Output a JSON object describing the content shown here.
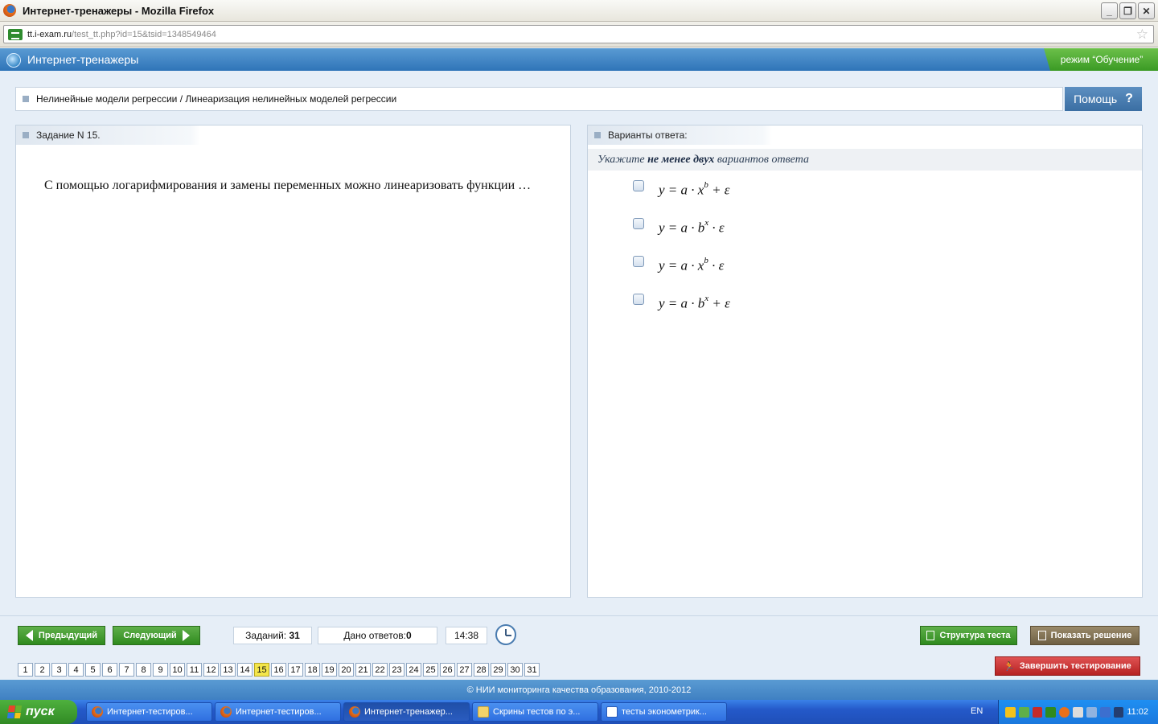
{
  "window": {
    "title": "Интернет-тренажеры - Mozilla Firefox",
    "url_domain": "tt.i-exam.ru",
    "url_path": "/test_tt.php?id=15&tsid=1348549464"
  },
  "app": {
    "title": "Интернет-тренажеры",
    "mode": "режим “Обучение”"
  },
  "topic": {
    "text": "Нелинейные модели регрессии / Линеаризация нелинейных моделей регрессии",
    "help_label": "Помощь",
    "help_symbol": "?"
  },
  "task": {
    "header": "Задание N 15.",
    "question": "С помощью логарифмирования и замены переменных можно линеаризовать функции …"
  },
  "answers": {
    "header": "Варианты ответа:",
    "instruction_pre": "Укажите ",
    "instruction_bold": "не менее двух",
    "instruction_post": " вариантов ответа",
    "options": [
      {
        "base": "y = a · x",
        "exp": "b",
        "tail": " + ε"
      },
      {
        "base": "y = a · b",
        "exp": "x",
        "tail": " · ε"
      },
      {
        "base": "y = a · x",
        "exp": "b",
        "tail": " · ε"
      },
      {
        "base": "y = a · b",
        "exp": "x",
        "tail": " + ε"
      }
    ]
  },
  "nav": {
    "prev_label": "Предыдущий",
    "next_label": "Следующий",
    "tasks_label": "Заданий:",
    "tasks_count": "31",
    "answers_label": "Дано ответов:",
    "answers_count": "0",
    "timer": "14:38",
    "structure_label": "Структура теста",
    "solution_label": "Показать решение",
    "finish_label": "Завершить тестирование",
    "pages": [
      "1",
      "2",
      "3",
      "4",
      "5",
      "6",
      "7",
      "8",
      "9",
      "10",
      "11",
      "12",
      "13",
      "14",
      "15",
      "16",
      "17",
      "18",
      "19",
      "20",
      "21",
      "22",
      "23",
      "24",
      "25",
      "26",
      "27",
      "28",
      "29",
      "30",
      "31"
    ],
    "current_page": "15"
  },
  "footer": {
    "copyright": "© НИИ мониторинга качества образования, 2010-2012"
  },
  "taskbar": {
    "start_label": "пуск",
    "tasks": [
      {
        "label": "Интернет-тестиров...",
        "icon": "firefox-icon"
      },
      {
        "label": "Интернет-тестиров...",
        "icon": "firefox-icon"
      },
      {
        "label": "Интернет-тренажер...",
        "icon": "firefox-icon"
      },
      {
        "label": "Скрины тестов по э...",
        "icon": "folder-icon"
      },
      {
        "label": "тесты эконометрик...",
        "icon": "word-icon"
      }
    ],
    "language": "EN",
    "clock": "11:02"
  },
  "colors": {
    "header_blue": "#2f74b8",
    "accent_green": "#3a9a24",
    "current_page": "#f4e64a",
    "finish_red": "#b52222"
  }
}
